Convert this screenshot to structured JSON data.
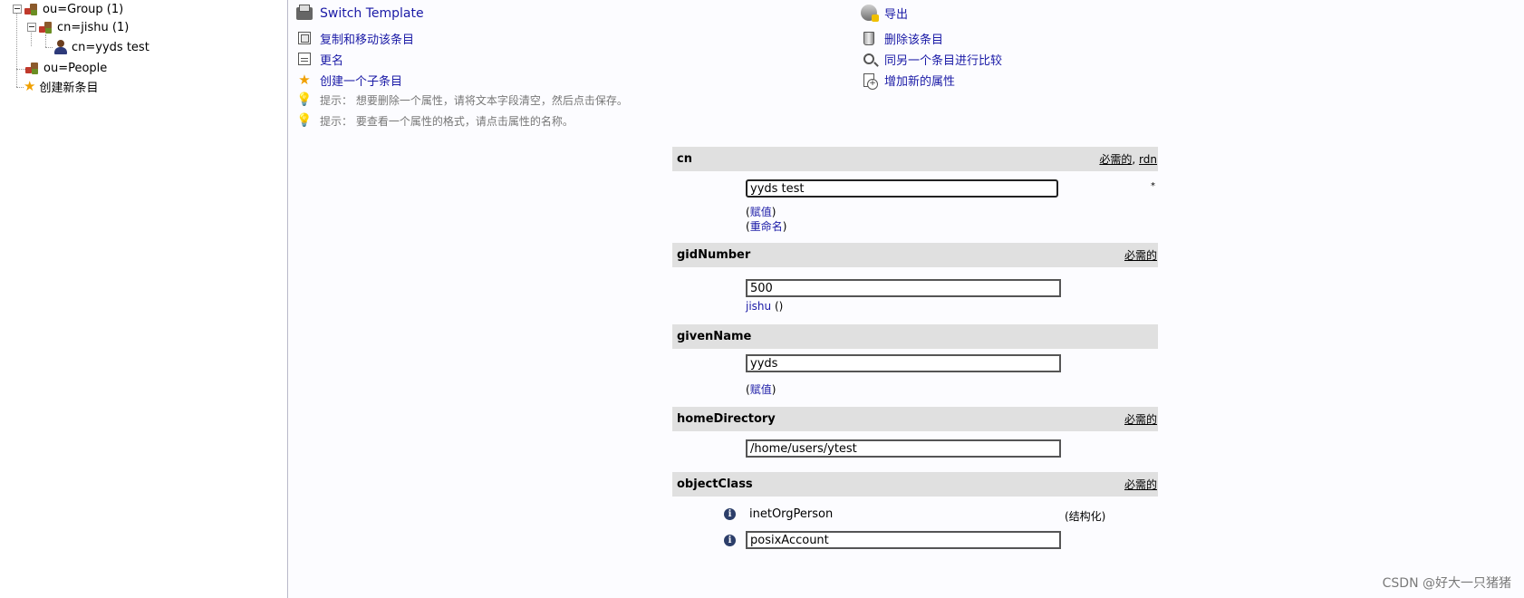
{
  "tree": {
    "items": [
      {
        "label": "ou=Group (1)"
      },
      {
        "label": "cn=jishu (1)"
      },
      {
        "label": "cn=yyds test"
      },
      {
        "label": "ou=People"
      },
      {
        "label": "创建新条目"
      }
    ]
  },
  "actions": {
    "switch_template": "Switch Template",
    "export": "导出",
    "copy_move": "复制和移动该条目",
    "delete": "删除该条目",
    "rename": "更名",
    "compare": "同另一个条目进行比较",
    "create_child": "创建一个子条目",
    "add_attribute": "增加新的属性"
  },
  "hints": [
    "提示：  想要删除一个属性，请将文本字段清空，然后点击保存。",
    "提示：  要查看一个属性的格式，请点击属性的名称。"
  ],
  "attributes": {
    "cn": {
      "name": "cn",
      "required": "必需的",
      "sep": ", ",
      "rdn": "rdn",
      "value": "yyds test",
      "mark": "*",
      "link1_open": "(",
      "link1": "赋值",
      "link1_close": ")",
      "link2_open": "(",
      "link2": "重命名",
      "link2_close": ")"
    },
    "gidNumber": {
      "name": "gidNumber",
      "required": "必需的",
      "value": "500",
      "group_link": "jishu",
      "group_suffix": " ()"
    },
    "givenName": {
      "name": "givenName",
      "value": "yyds",
      "link_open": "(",
      "link": "赋值",
      "link_close": ")"
    },
    "homeDirectory": {
      "name": "homeDirectory",
      "required": "必需的",
      "value": "/home/users/ytest"
    },
    "objectClass": {
      "name": "objectClass",
      "required": "必需的",
      "value1": "inetOrgPerson",
      "value1_note": "(结构化)",
      "value2": "posixAccount"
    }
  },
  "watermark": "CSDN @好大一只猪猪"
}
